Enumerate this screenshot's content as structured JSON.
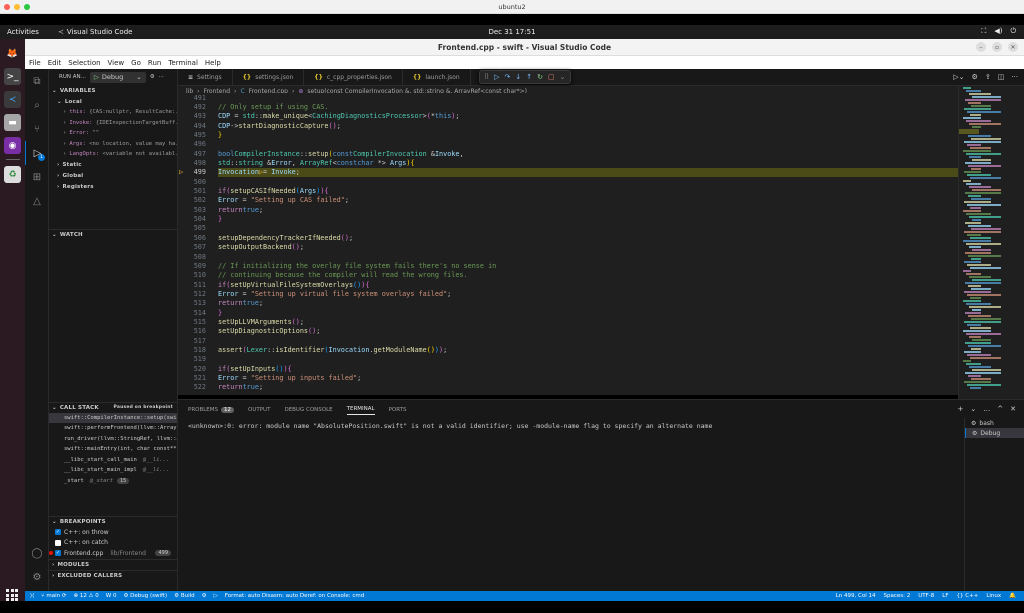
{
  "mac_window": {
    "title": "ubuntu2",
    "dots": [
      "#fe5f57",
      "#febc2e",
      "#28c840"
    ]
  },
  "gnome": {
    "activities": "Activities",
    "app_name": "Visual Studio Code",
    "clock": "Dec 31  17:51",
    "tray": [
      "network-icon",
      "volume-icon",
      "power-icon"
    ]
  },
  "dock": {
    "apps": [
      {
        "name": "firefox",
        "glyph": "🦊",
        "bg": "transparent"
      },
      {
        "name": "terminal",
        "glyph": ">_",
        "bg": "#444"
      },
      {
        "name": "vscode",
        "glyph": "≺",
        "bg": "#3a3a3a"
      },
      {
        "name": "files",
        "glyph": "▬",
        "bg": "#a6a6a6"
      },
      {
        "name": "github-desktop",
        "glyph": "◉",
        "bg": "#7a2ea6"
      },
      {
        "name": "trash",
        "glyph": "♻",
        "bg": "#ddd"
      }
    ]
  },
  "window": {
    "title": "Frontend.cpp - swift - Visual Studio Code",
    "controls": [
      "–",
      "▫",
      "✕"
    ]
  },
  "menu": [
    "File",
    "Edit",
    "Selection",
    "View",
    "Go",
    "Run",
    "Terminal",
    "Help"
  ],
  "sidebar": {
    "run_label": "RUN AN...",
    "debug_config": "Debug",
    "variables_header": "VARIABLES",
    "local_label": "Local",
    "locals": [
      {
        "name": "this:",
        "value": "{CAS:nullptr, ResultCache:..."
      },
      {
        "name": "Invoke:",
        "value": "{IDEInspectionTargetBuff..."
      },
      {
        "name": "Error:",
        "value": "\"\""
      },
      {
        "name": "Args:",
        "value": "<no location, value may ha..."
      },
      {
        "name": "LangOpts:",
        "value": "<variable not availabl..."
      }
    ],
    "scopes": [
      "Static",
      "Global",
      "Registers"
    ],
    "watch_header": "WATCH",
    "callstack_header": "CALL STACK",
    "callstack_status": "Paused on breakpoint",
    "frames": [
      {
        "fn": "swift::CompilerInstance::setup(swift",
        "src": "",
        "count": ""
      },
      {
        "fn": "swift::performFrontend(llvm::ArrayR",
        "src": "",
        "count": ""
      },
      {
        "fn": "run_driver(llvm::StringRef, llvm::A",
        "src": "",
        "count": ""
      },
      {
        "fn": "swift::mainEntry(int, char const**)",
        "src": "",
        "count": ""
      },
      {
        "fn": "__libc_start_call_main",
        "src": "@__li...",
        "count": ""
      },
      {
        "fn": "__libc_start_main_impl",
        "src": "@__li...",
        "count": ""
      },
      {
        "fn": "_start",
        "src": "@_start",
        "count": "15"
      }
    ],
    "breakpoints_header": "BREAKPOINTS",
    "breakpoints": [
      {
        "label": "C++: on throw",
        "checked": true,
        "path": "",
        "line": ""
      },
      {
        "label": "C++: on catch",
        "checked": false,
        "path": "",
        "line": ""
      },
      {
        "label": "Frontend.cpp",
        "checked": true,
        "path": "lib/Frontend",
        "line": "499"
      }
    ],
    "modules_header": "MODULES",
    "excluded_header": "EXCLUDED CALLERS"
  },
  "tabs": [
    {
      "label": "Settings",
      "icon": "≡"
    },
    {
      "label": "settings.json",
      "icon": "{}"
    },
    {
      "label": "c_cpp_properties.json",
      "icon": "{}"
    },
    {
      "label": "launch.json",
      "icon": "{}"
    },
    {
      "label": "",
      "icon": "C"
    }
  ],
  "debug_toolbar": [
    {
      "name": "drag-handle-icon",
      "glyph": "⠿",
      "color": "#888"
    },
    {
      "name": "continue-icon",
      "glyph": "▷",
      "color": "#75beff"
    },
    {
      "name": "step-over-icon",
      "glyph": "↷",
      "color": "#75beff"
    },
    {
      "name": "step-into-icon",
      "glyph": "↓",
      "color": "#75beff"
    },
    {
      "name": "step-out-icon",
      "glyph": "↑",
      "color": "#75beff"
    },
    {
      "name": "restart-icon",
      "glyph": "↻",
      "color": "#89d185"
    },
    {
      "name": "stop-icon",
      "glyph": "▢",
      "color": "#f48771"
    },
    {
      "name": "chevron-down-icon",
      "glyph": "⌄",
      "color": "#888"
    }
  ],
  "editor_actions": [
    "run-debug-icon",
    "gear-icon",
    "upload-icon",
    "split-editor-icon",
    "more-icon"
  ],
  "breadcrumb": [
    "lib",
    "Frontend",
    "Frontend.cpp",
    "setup(const CompilerInvocation &, std::string &, ArrayRef<const char*>)"
  ],
  "code_lines": [
    {
      "n": "491",
      "html": ""
    },
    {
      "n": "492",
      "html": "  <span class='c'>// Only setup if using CAS.</span>"
    },
    {
      "n": "493",
      "html": "  <span class='v'>CDP</span> = <span class='t'>std</span>::<span class='f'>make_unique</span>&lt;<span class='t'>CachingDiagnosticsProcessor</span>&gt;<span class='b2'>(</span>*<span class='k'>this</span><span class='b2'>)</span>;"
    },
    {
      "n": "494",
      "html": "  <span class='v'>CDP</span>-&gt;<span class='f'>startDiagnosticCapture</span><span class='b2'>()</span>;"
    },
    {
      "n": "495",
      "html": "<span class='b1'>}</span>"
    },
    {
      "n": "496",
      "html": ""
    },
    {
      "n": "497",
      "html": "<span class='k'>bool</span> <span class='t'>CompilerInstance</span>::<span class='f'>setup</span><span class='b1'>(</span><span class='k'>const</span> <span class='t'>CompilerInvocation</span> &amp;<span class='v'>Invoke</span>,"
    },
    {
      "n": "498",
      "html": "                             <span class='t'>std</span>::<span class='t'>string</span> &amp;<span class='v'>Error</span>, <span class='t'>ArrayRef</span>&lt;<span class='k'>const</span> <span class='k'>char</span> *&gt; <span class='v'>Args</span><span class='b1'>)</span> <span class='b1'>{</span>"
    },
    {
      "n": "499",
      "html": "  <span class='v'>Invocation</span> <span style='color:#f9c22e'>▷</span>= <span class='v'>Invoke</span>;",
      "current": true
    },
    {
      "n": "500",
      "html": ""
    },
    {
      "n": "501",
      "html": "  <span class='kc'>if</span> <span class='b2'>(</span><span class='f'>setupCASIfNeeded</span><span class='b3'>(</span><span class='v'>Args</span><span class='b3'>)</span><span class='b2'>)</span> <span class='b2'>{</span>"
    },
    {
      "n": "502",
      "html": "    <span class='v'>Error</span> = <span class='s'>\"Setting up CAS failed\"</span>;"
    },
    {
      "n": "503",
      "html": "    <span class='kc'>return</span> <span class='k'>true</span>;"
    },
    {
      "n": "504",
      "html": "  <span class='b2'>}</span>"
    },
    {
      "n": "505",
      "html": ""
    },
    {
      "n": "506",
      "html": "  <span class='f'>setupDependencyTrackerIfNeeded</span><span class='b2'>()</span>;"
    },
    {
      "n": "507",
      "html": "  <span class='f'>setupOutputBackend</span><span class='b2'>()</span>;"
    },
    {
      "n": "508",
      "html": ""
    },
    {
      "n": "509",
      "html": "  <span class='c'>// If initializing the overlay file system fails there's no sense in</span>"
    },
    {
      "n": "510",
      "html": "  <span class='c'>// continuing because the compiler will read the wrong files.</span>"
    },
    {
      "n": "511",
      "html": "  <span class='kc'>if</span> <span class='b2'>(</span><span class='f'>setUpVirtualFileSystemOverlays</span><span class='b3'>()</span><span class='b2'>)</span> <span class='b2'>{</span>"
    },
    {
      "n": "512",
      "html": "    <span class='v'>Error</span> = <span class='s'>\"Setting up virtual file system overlays failed\"</span>;"
    },
    {
      "n": "513",
      "html": "    <span class='kc'>return</span> <span class='k'>true</span>;"
    },
    {
      "n": "514",
      "html": "  <span class='b2'>}</span>"
    },
    {
      "n": "515",
      "html": "  <span class='f'>setUpLLVMArguments</span><span class='b2'>()</span>;"
    },
    {
      "n": "516",
      "html": "  <span class='f'>setUpDiagnosticOptions</span><span class='b2'>()</span>;"
    },
    {
      "n": "517",
      "html": ""
    },
    {
      "n": "518",
      "html": "  <span class='f'>assert</span><span class='b2'>(</span><span class='t'>Lexer</span>::<span class='f'>isIdentifier</span><span class='b3'>(</span><span class='v'>Invocation</span>.<span class='f'>getModuleName</span><span class='b1'>()</span><span class='b3'>)</span><span class='b2'>)</span>;"
    },
    {
      "n": "519",
      "html": ""
    },
    {
      "n": "520",
      "html": "  <span class='kc'>if</span> <span class='b2'>(</span><span class='f'>setUpInputs</span><span class='b3'>()</span><span class='b2'>)</span> <span class='b2'>{</span>"
    },
    {
      "n": "521",
      "html": "    <span class='v'>Error</span> = <span class='s'>\"Setting up inputs failed\"</span>;"
    },
    {
      "n": "522",
      "html": "    <span class='kc'>return</span> <span class='k'>true</span>;"
    }
  ],
  "panel": {
    "tabs": [
      {
        "label": "PROBLEMS",
        "badge": "12"
      },
      {
        "label": "OUTPUT",
        "badge": ""
      },
      {
        "label": "DEBUG CONSOLE",
        "badge": ""
      },
      {
        "label": "TERMINAL",
        "badge": "",
        "active": true
      },
      {
        "label": "PORTS",
        "badge": ""
      }
    ],
    "terminal_output": "<unknown>:0: error: module name \"AbsolutePosition.swift\" is not a valid identifier; use -module-name flag to specify an alternate name",
    "terminals": [
      {
        "label": "bash",
        "icon": "⚙"
      },
      {
        "label": "Debug",
        "icon": "⚙",
        "selected": true
      }
    ],
    "actions": [
      "+",
      "⌄",
      "…",
      "^",
      "✕"
    ]
  },
  "statusbar": {
    "remote": "⟩⟨",
    "branch": "main",
    "sync": "⟳",
    "errors": "12",
    "warnings": "0",
    "w": "W 0",
    "debug": "Debug (swift)",
    "build": "Build",
    "gear": "⚙",
    "run": "▷",
    "format": "Format: auto  Disasm: auto  Deref: on  Console: cmd",
    "position": "Ln 499, Col 14",
    "spaces": "Spaces: 2",
    "encoding": "UTF-8",
    "eol": "LF",
    "language": "{} C++",
    "platform": "Linux",
    "bell": "🔔"
  }
}
